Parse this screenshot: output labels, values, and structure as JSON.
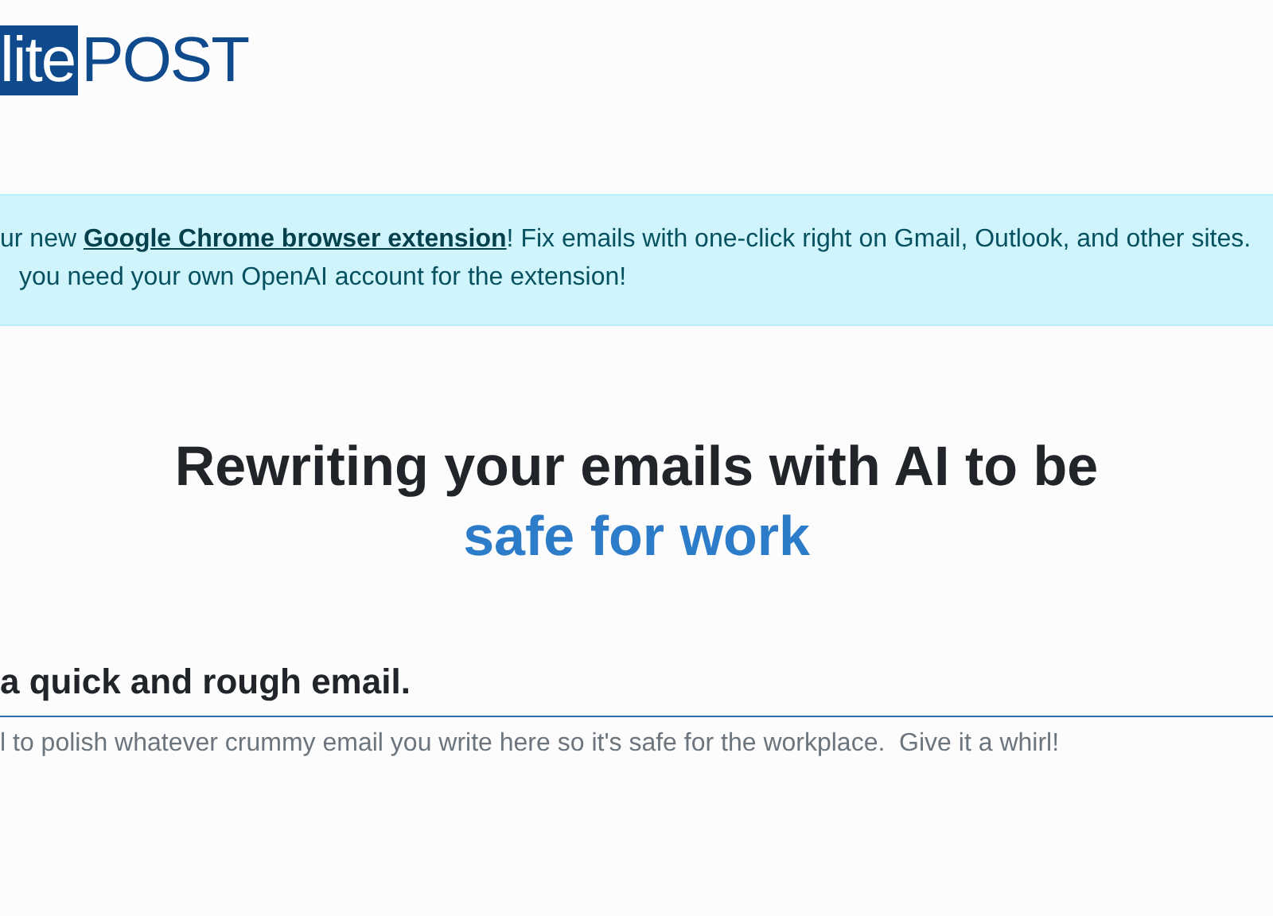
{
  "logo": {
    "boxed": "lite",
    "plain": "POST"
  },
  "banner": {
    "line_1_before": "ur new ",
    "link": "Google Chrome browser extension",
    "line_1_after": "! Fix emails with one-click right on Gmail, Outlook, and other sites.",
    "line_2": "you need your own OpenAI account for the extension!"
  },
  "hero": {
    "title": "Rewriting your emails with AI to be",
    "highlight": "safe for work"
  },
  "form": {
    "heading": "a quick and rough email.",
    "placeholder": "l to polish whatever crummy email you write here so it's safe for the workplace.  Give it a whirl!"
  }
}
